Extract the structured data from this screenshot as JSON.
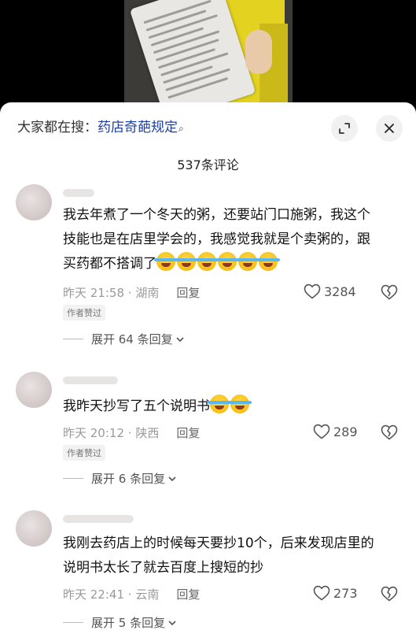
{
  "header": {
    "search_prefix": "大家都在搜：",
    "search_keyword": "药店奇葩规定",
    "comment_count": "537条评论"
  },
  "icons": {
    "search": "search-icon",
    "expand": "expand-icon",
    "close": "close-icon",
    "like": "heart-icon",
    "dislike": "broken-heart-icon",
    "chevron": "chevron-down-icon"
  },
  "comments": [
    {
      "text": "我去年煮了一个冬天的粥，还要站门口施粥，我这个技能也是在店里学会的，我感觉我就是个卖粥的，跟买药都不搭调了",
      "emoji_count": 6,
      "time": "昨天 21:58",
      "location": "湖南",
      "reply_label": "回复",
      "likes": "3284",
      "badge": "作者赞过",
      "expand_label": "展开 64 条回复"
    },
    {
      "text": "我昨天抄写了五个说明书",
      "emoji_count": 2,
      "time": "昨天 20:12",
      "location": "陕西",
      "reply_label": "回复",
      "likes": "289",
      "badge": "作者赞过",
      "expand_label": "展开 6 条回复"
    },
    {
      "text": "我刚去药店上的时候每天要抄10个，后来发现店里的说明书太长了就去百度上搜短的抄",
      "emoji_count": 0,
      "time": "昨天 22:41",
      "location": "云南",
      "reply_label": "回复",
      "likes": "273",
      "badge": "",
      "expand_label": "展开 5 条回复"
    }
  ]
}
